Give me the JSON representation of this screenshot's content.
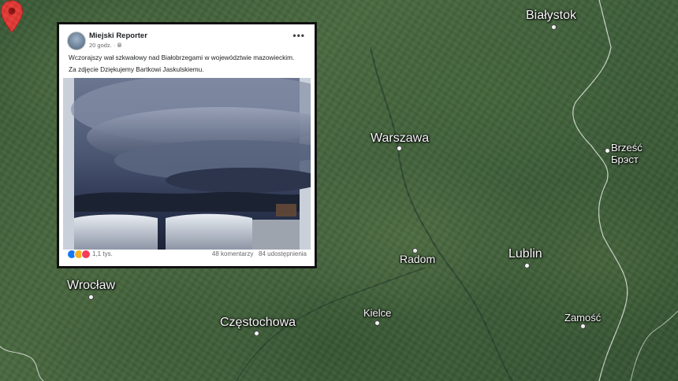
{
  "map": {
    "cities": [
      {
        "id": "bialystok",
        "name": "Białystok"
      },
      {
        "id": "warszawa",
        "name": "Warszawa"
      },
      {
        "id": "brzesc",
        "name": "Brześć",
        "name2": "Брэст"
      },
      {
        "id": "radom",
        "name": "Radom"
      },
      {
        "id": "lublin",
        "name": "Lublin"
      },
      {
        "id": "wroclaw",
        "name": "Wrocław"
      },
      {
        "id": "czestochowa",
        "name": "Częstochowa"
      },
      {
        "id": "kielce",
        "name": "Kielce"
      },
      {
        "id": "zamosc",
        "name": "Zamość"
      }
    ],
    "marker_icon": "location-pin-icon",
    "marker_color": "#e53935"
  },
  "post": {
    "author": "Miejski Reporter",
    "time": "20 godz.",
    "privacy_icon": "globe-icon",
    "more_icon": "more-options-icon",
    "text_line1": "Wczorajszy wał szkwałowy nad Białobrzegami w województwie mazowieckim.",
    "text_line2": "Za zdjęcie Dziękujemy Bartkowi Jaskulskiemu.",
    "photo_icon": "storm-photo",
    "reactions": "1,1 tys.",
    "comments": "48 komentarzy",
    "shares": "84 udostępnienia"
  }
}
